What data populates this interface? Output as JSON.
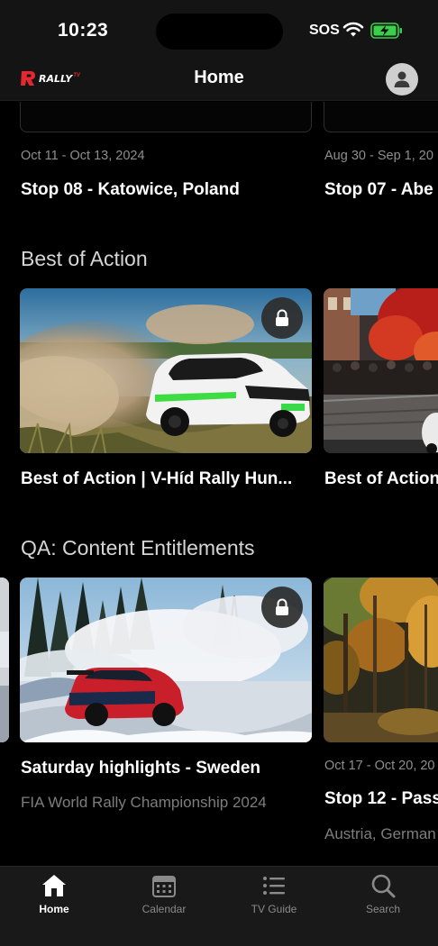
{
  "status_bar": {
    "time": "10:23",
    "carrier": "SOS"
  },
  "header": {
    "logo_text": "RALLY",
    "logo_suffix": "TV",
    "title": "Home"
  },
  "upcoming_row": {
    "cards": [
      {
        "date": "Oct 11 - Oct 13, 2024",
        "title": "Stop 08 - Katowice, Poland"
      },
      {
        "date": "Aug 30 - Sep 1, 20",
        "title": "Stop 07 - Abe"
      }
    ]
  },
  "best_of_action": {
    "title": "Best of Action",
    "cards": [
      {
        "title": "Best of Action | V-Híd Rally Hun...",
        "locked": true
      },
      {
        "title": "Best of Action"
      }
    ]
  },
  "qa_content": {
    "title": "QA: Content Entitlements",
    "cards": [
      {
        "title": "Saturday highlights - Sweden",
        "subtitle": "FIA World Rally Championship 2024",
        "locked": true
      },
      {
        "date": "Oct 17 - Oct 20, 20",
        "title": "Stop 12 - Pass",
        "subtitle": "Austria, German"
      }
    ]
  },
  "tab_bar": {
    "tabs": [
      {
        "label": "Home",
        "icon": "home-icon",
        "active": true
      },
      {
        "label": "Calendar",
        "icon": "calendar-icon"
      },
      {
        "label": "TV Guide",
        "icon": "list-icon"
      },
      {
        "label": "Search",
        "icon": "search-icon"
      }
    ]
  },
  "colors": {
    "brand": "#e3282f",
    "background": "#000000",
    "bar": "#141414",
    "battery": "#3ad04a"
  }
}
